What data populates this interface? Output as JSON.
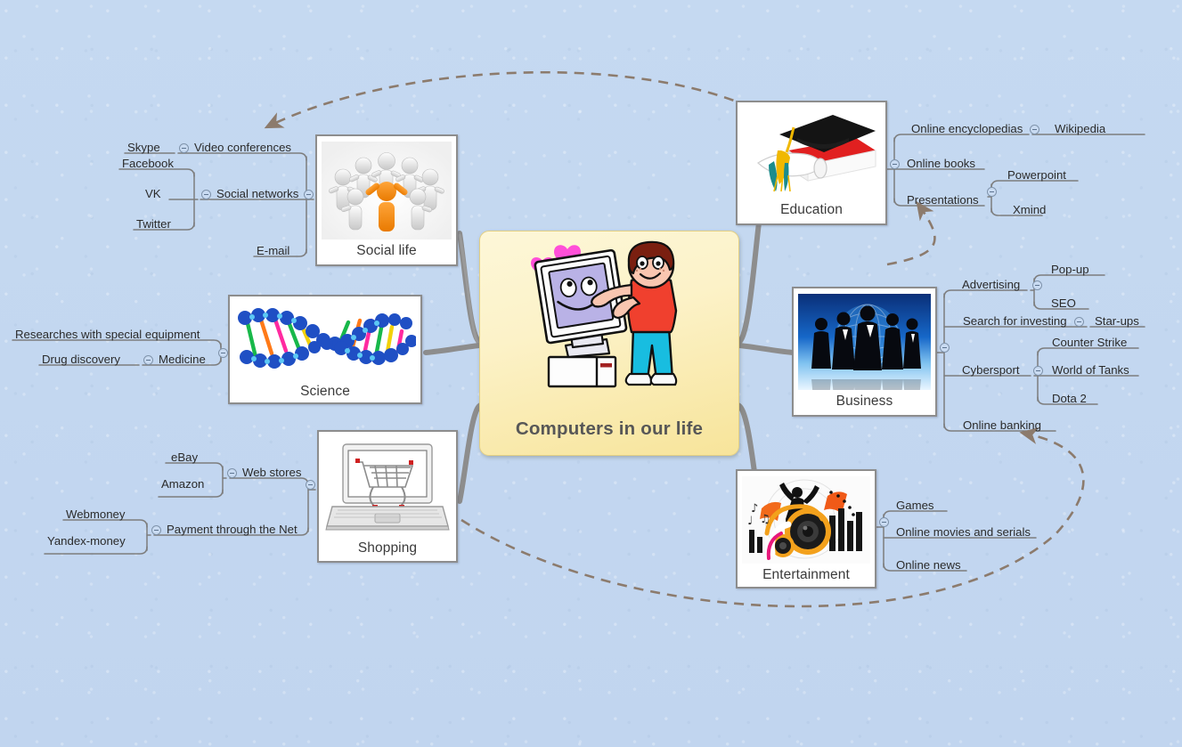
{
  "background_color": "#c3d7f0",
  "central": {
    "title": "Computers in our life",
    "icon": "boy-hugging-computer-image",
    "fill_color": "#faeec0",
    "text_color": "#575757"
  },
  "line_color": "#7d7d7d",
  "relation_color": "#8c7b6d",
  "topics": [
    {
      "id": "social-life",
      "label": "Social life",
      "icon": "people-holding-hands-image",
      "side": "left",
      "subtopics": [
        {
          "label": "Video conferences",
          "children": [
            "Skype"
          ]
        },
        {
          "label": "Social networks",
          "children": [
            "Facebook",
            "VK",
            "Twitter"
          ]
        },
        {
          "label": "E-mail",
          "children": []
        }
      ]
    },
    {
      "id": "science",
      "label": "Science",
      "icon": "dna-helix-image",
      "side": "left",
      "subtopics": [
        {
          "label": "Researches with special equipment",
          "children": []
        },
        {
          "label": "Medicine",
          "children": [
            "Drug discovery"
          ]
        }
      ]
    },
    {
      "id": "shopping",
      "label": "Shopping",
      "icon": "laptop-shopping-cart-image",
      "side": "left",
      "subtopics": [
        {
          "label": "Web stores",
          "children": [
            "eBay",
            "Amazon"
          ]
        },
        {
          "label": "Payment through the Net",
          "children": [
            "Webmoney",
            "Yandex-money"
          ]
        }
      ]
    },
    {
      "id": "education",
      "label": "Education",
      "icon": "graduation-cap-diploma-image",
      "side": "right",
      "subtopics": [
        {
          "label": "Online encyclopedias",
          "children": [
            "Wikipedia"
          ]
        },
        {
          "label": "Online books",
          "children": []
        },
        {
          "label": "Presentations",
          "children": [
            "Powerpoint",
            "Xmind"
          ]
        }
      ]
    },
    {
      "id": "business",
      "label": "Business",
      "icon": "business-people-globe-image",
      "side": "right",
      "subtopics": [
        {
          "label": "Advertising",
          "children": [
            "Pop-up",
            "SEO"
          ]
        },
        {
          "label": "Search for investing",
          "children": [
            "Star-ups"
          ]
        },
        {
          "label": "Cybersport",
          "children": [
            "Counter Strike",
            "World of Tanks",
            "Dota 2"
          ]
        },
        {
          "label": "Online banking",
          "children": []
        }
      ]
    },
    {
      "id": "entertainment",
      "label": "Entertainment",
      "icon": "music-party-image",
      "side": "right",
      "subtopics": [
        {
          "label": "Games",
          "children": []
        },
        {
          "label": "Online movies and serials",
          "children": []
        },
        {
          "label": "Online news",
          "children": []
        }
      ]
    }
  ],
  "labels": {
    "social_life": "Social life",
    "science": "Science",
    "shopping": "Shopping",
    "education": "Education",
    "business": "Business",
    "entertainment": "Entertainment",
    "skype": "Skype",
    "video_conferences": "Video conferences",
    "facebook": "Facebook",
    "vk": "VK",
    "twitter": "Twitter",
    "social_networks": "Social networks",
    "email": "E-mail",
    "researches": "Researches with special equipment",
    "drug_discovery": "Drug discovery",
    "medicine": "Medicine",
    "ebay": "eBay",
    "amazon": "Amazon",
    "web_stores": "Web stores",
    "webmoney": "Webmoney",
    "yandex_money": "Yandex-money",
    "payment_net": "Payment through the Net",
    "online_encyclopedias": "Online encyclopedias",
    "wikipedia": "Wikipedia",
    "online_books": "Online books",
    "presentations": "Presentations",
    "powerpoint": "Powerpoint",
    "xmind": "Xmind",
    "advertising": "Advertising",
    "popup": "Pop-up",
    "seo": "SEO",
    "search_investing": "Search for investing",
    "starups": "Star-ups",
    "cybersport": "Cybersport",
    "counter_strike": "Counter Strike",
    "world_of_tanks": "World of Tanks",
    "dota2": "Dota 2",
    "online_banking": "Online banking",
    "games": "Games",
    "online_movies": "Online movies and serials",
    "online_news": "Online news"
  },
  "relationships": [
    {
      "from": "business",
      "to": "video-conferences",
      "style": "dashed-arrow"
    },
    {
      "from": "business",
      "to": "presentations",
      "style": "dashed-arrow"
    },
    {
      "from": "shopping",
      "to": "online-banking",
      "style": "dashed-arrow"
    }
  ]
}
